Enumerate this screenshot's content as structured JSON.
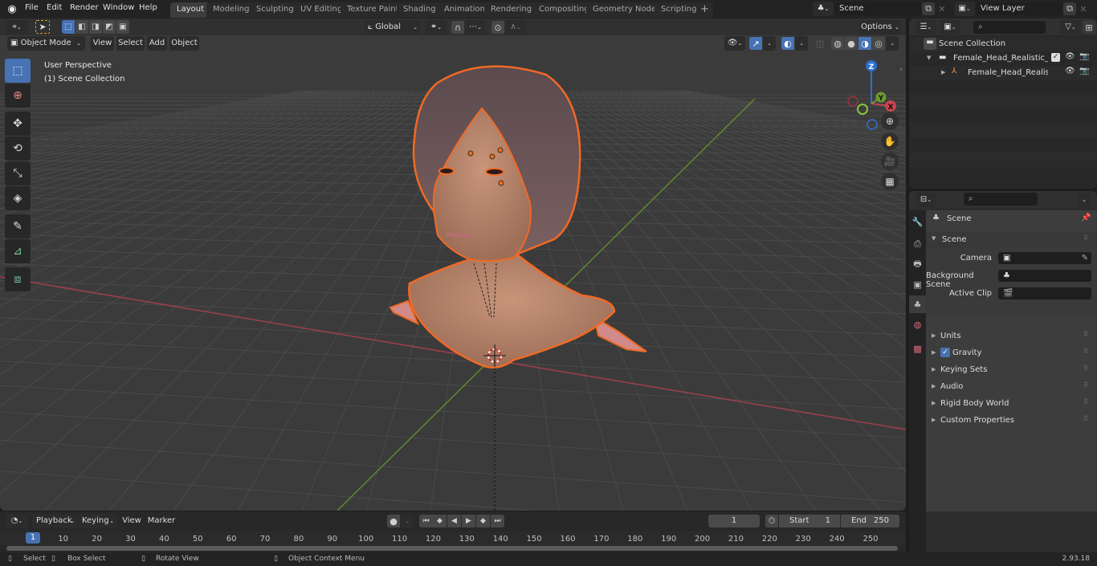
{
  "topbar": {
    "menus": [
      "File",
      "Edit",
      "Render",
      "Window",
      "Help"
    ],
    "workspaces": [
      "Layout",
      "Modeling",
      "Sculpting",
      "UV Editing",
      "Texture Paint",
      "Shading",
      "Animation",
      "Rendering",
      "Compositing",
      "Geometry Nodes",
      "Scripting"
    ],
    "active_workspace": "Layout",
    "add_tab": "+",
    "scene_name": "Scene",
    "view_layer_name": "View Layer"
  },
  "viewport": {
    "mode": "Object Mode",
    "menus": [
      "View",
      "Select",
      "Add",
      "Object"
    ],
    "transform_orientation": "Global",
    "options_label": "Options",
    "overlay_text_1": "User Perspective",
    "overlay_text_2": "(1) Scene Collection",
    "gizmo": {
      "x": "X",
      "y": "Y",
      "z": "Z"
    },
    "tools": [
      "select-box",
      "cursor",
      "move",
      "rotate",
      "scale",
      "transform",
      "annotate",
      "measure",
      "add-cube"
    ],
    "axis_colors": {
      "x": "#c74551",
      "y": "#6b9a2f",
      "z": "#2f6fd0",
      "selection": "#f06a25"
    }
  },
  "outliner": {
    "root": "Scene Collection",
    "items": [
      {
        "name": "Female_Head_Realistic_Anatı",
        "type": "collection",
        "indent": 1
      },
      {
        "name": "Female_Head_Realistic_/",
        "type": "armature",
        "indent": 2
      }
    ]
  },
  "properties": {
    "context": "Scene",
    "section": "Scene",
    "fields": [
      {
        "label": "Camera",
        "value": ""
      },
      {
        "label": "Background Scene",
        "value": ""
      },
      {
        "label": "Active Clip",
        "value": ""
      }
    ],
    "subpanels": [
      "Units",
      "Gravity",
      "Keying Sets",
      "Audio",
      "Rigid Body World",
      "Custom Properties"
    ],
    "gravity_checked": true
  },
  "timeline": {
    "menus": [
      "Playback",
      "Keying",
      "View",
      "Marker"
    ],
    "current_frame": "1",
    "start_label": "Start",
    "start": "1",
    "end_label": "End",
    "end": "250",
    "ticks": [
      "10",
      "20",
      "30",
      "40",
      "50",
      "60",
      "70",
      "80",
      "90",
      "100",
      "110",
      "120",
      "130",
      "140",
      "150",
      "160",
      "170",
      "180",
      "190",
      "200",
      "210",
      "220",
      "230",
      "240",
      "250"
    ]
  },
  "statusbar": {
    "select": "Select",
    "box_select": "Box Select",
    "rotate_view": "Rotate View",
    "context_menu": "Object Context Menu",
    "version": "2.93.18"
  }
}
